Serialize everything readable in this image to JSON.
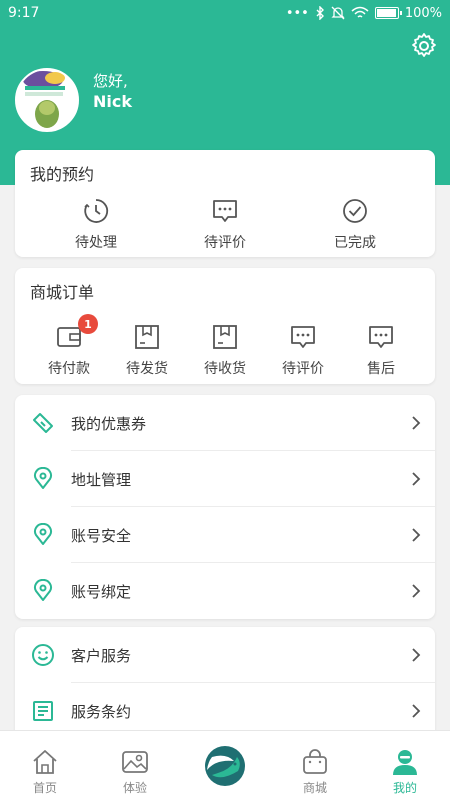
{
  "status_bar": {
    "time": "9:17",
    "battery": "100%",
    "battery_level": 1.0
  },
  "profile": {
    "greeting": "您好,",
    "name": "Nick"
  },
  "appointments": {
    "title": "我的预约",
    "items": [
      {
        "label": "待处理",
        "icon": "clock-icon"
      },
      {
        "label": "待评价",
        "icon": "comment-icon"
      },
      {
        "label": "已完成",
        "icon": "check-circle-icon"
      }
    ]
  },
  "orders": {
    "title": "商城订单",
    "items": [
      {
        "label": "待付款",
        "icon": "wallet-icon",
        "badge": "1"
      },
      {
        "label": "待发货",
        "icon": "box-icon"
      },
      {
        "label": "待收货",
        "icon": "box-icon"
      },
      {
        "label": "待评价",
        "icon": "comment-icon"
      },
      {
        "label": "售后",
        "icon": "comment-icon"
      }
    ]
  },
  "menu1": [
    {
      "label": "我的优惠券",
      "icon": "coupon-icon"
    },
    {
      "label": "地址管理",
      "icon": "location-icon"
    },
    {
      "label": "账号安全",
      "icon": "location-icon"
    },
    {
      "label": "账号绑定",
      "icon": "location-icon"
    }
  ],
  "menu2": [
    {
      "label": "客户服务",
      "icon": "smile-icon"
    },
    {
      "label": "服务条约",
      "icon": "document-icon"
    }
  ],
  "tabbar": [
    {
      "label": "首页",
      "icon": "home-icon"
    },
    {
      "label": "体验",
      "icon": "image-icon"
    },
    {
      "label": "",
      "icon": "bird-logo-icon"
    },
    {
      "label": "商城",
      "icon": "shopping-bag-icon"
    },
    {
      "label": "我的",
      "icon": "user-icon"
    }
  ],
  "colors": {
    "accent": "#2bb895",
    "badge": "#e84a3c"
  }
}
